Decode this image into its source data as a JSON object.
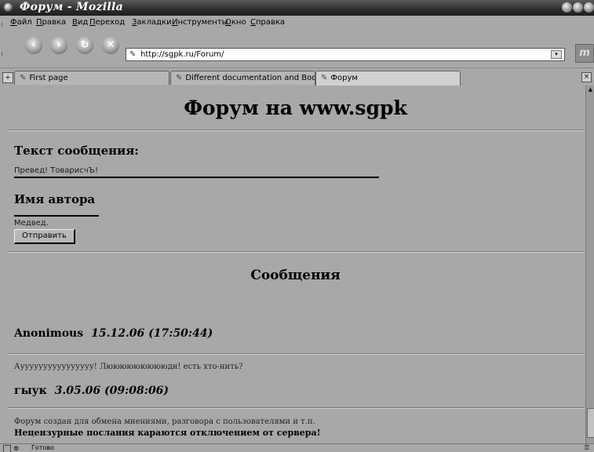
{
  "window": {
    "title": "Форум - Mozilla"
  },
  "menu": [
    "Файл",
    "Правка",
    "Вид",
    "Переход",
    "Закладки",
    "Инструменты",
    "Окно",
    "Справка"
  ],
  "menu_underline_chars": [
    "Ф",
    "П",
    "В",
    "П",
    "З",
    "И",
    "О",
    "С"
  ],
  "nav": {
    "url": "http://sgpk.ru/Forum/"
  },
  "tabs": [
    {
      "label": "First page",
      "active": false
    },
    {
      "label": "Different documentation and Bookz",
      "active": false
    },
    {
      "label": "Форум",
      "active": true
    }
  ],
  "page": {
    "heading": "Форум на www.sgpk",
    "message_label": "Текст сообщения:",
    "message_value": "Превед! ТоварисчЪ!",
    "author_label": "Имя автора",
    "author_value": "Медвед.",
    "submit_label": "Отправить",
    "messages_heading": "Сообщения",
    "messages": [
      {
        "author": "Anonimous",
        "date": "15.12.06 (17:50:44)",
        "text": "Ауууууууууууууууу! Люююююююююди! есть хто-нить?"
      },
      {
        "author": "гыук",
        "date": "3.05.06 (09:08:06)",
        "text": ""
      }
    ],
    "footer_line1": "Форум создан для обмена мнениями, разговора с пользователями и т.п.",
    "footer_line2": "Нецензурные послания караются отключением от сервера!"
  },
  "status": {
    "text": "Готово"
  },
  "colors": {
    "background": "#a8a8a8",
    "titlebar": "#2e2e2e"
  }
}
